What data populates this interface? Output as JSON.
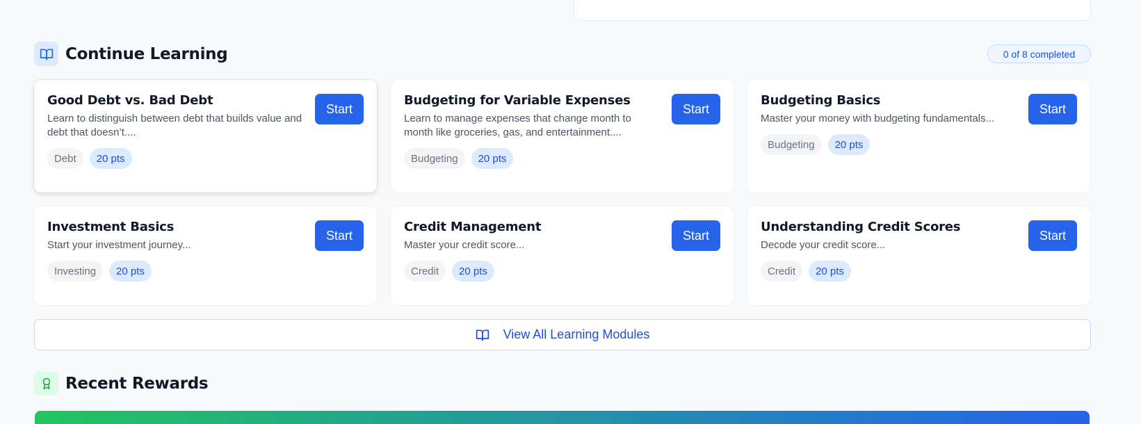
{
  "continue_learning": {
    "title": "Continue Learning",
    "icon": "book-open-icon",
    "progress": "0 of 8 completed"
  },
  "modules": [
    {
      "title": "Good Debt vs. Bad Debt",
      "description": "Learn to distinguish between debt that builds value and debt that doesn’t....",
      "category": "Debt",
      "points": "20 pts",
      "button": "Start"
    },
    {
      "title": "Budgeting for Variable Expenses",
      "description": "Learn to manage expenses that change month to month like groceries, gas, and entertainment....",
      "category": "Budgeting",
      "points": "20 pts",
      "button": "Start"
    },
    {
      "title": "Budgeting Basics",
      "description": "Master your money with budgeting fundamentals...",
      "category": "Budgeting",
      "points": "20 pts",
      "button": "Start"
    },
    {
      "title": "Investment Basics",
      "description": "Start your investment journey...",
      "category": "Investing",
      "points": "20 pts",
      "button": "Start"
    },
    {
      "title": "Credit Management",
      "description": "Master your credit score...",
      "category": "Credit",
      "points": "20 pts",
      "button": "Start"
    },
    {
      "title": "Understanding Credit Scores",
      "description": "Decode your credit score...",
      "category": "Credit",
      "points": "20 pts",
      "button": "Start"
    }
  ],
  "view_all": {
    "label": "View All Learning Modules",
    "icon": "book-open-icon"
  },
  "recent_rewards": {
    "title": "Recent Rewards",
    "icon": "award-icon"
  },
  "colors": {
    "accent": "#2563eb",
    "pill_blue": "#dbeafe",
    "reward_gradient_start": "#22c55e",
    "reward_gradient_end": "#2563eb"
  }
}
